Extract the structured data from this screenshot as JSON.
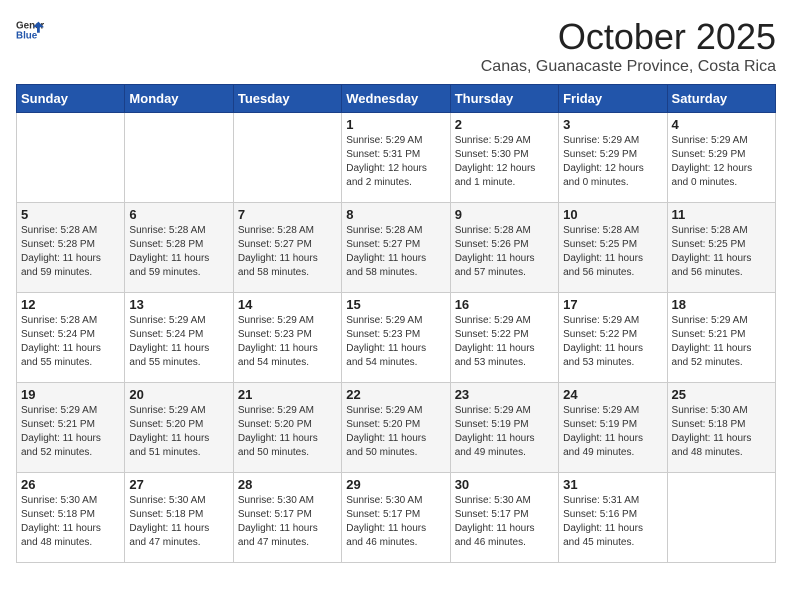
{
  "logo": {
    "general": "General",
    "blue": "Blue"
  },
  "title": "October 2025",
  "location": "Canas, Guanacaste Province, Costa Rica",
  "days_of_week": [
    "Sunday",
    "Monday",
    "Tuesday",
    "Wednesday",
    "Thursday",
    "Friday",
    "Saturday"
  ],
  "weeks": [
    [
      {
        "day": "",
        "info": ""
      },
      {
        "day": "",
        "info": ""
      },
      {
        "day": "",
        "info": ""
      },
      {
        "day": "1",
        "info": "Sunrise: 5:29 AM\nSunset: 5:31 PM\nDaylight: 12 hours\nand 2 minutes."
      },
      {
        "day": "2",
        "info": "Sunrise: 5:29 AM\nSunset: 5:30 PM\nDaylight: 12 hours\nand 1 minute."
      },
      {
        "day": "3",
        "info": "Sunrise: 5:29 AM\nSunset: 5:29 PM\nDaylight: 12 hours\nand 0 minutes."
      },
      {
        "day": "4",
        "info": "Sunrise: 5:29 AM\nSunset: 5:29 PM\nDaylight: 12 hours\nand 0 minutes."
      }
    ],
    [
      {
        "day": "5",
        "info": "Sunrise: 5:28 AM\nSunset: 5:28 PM\nDaylight: 11 hours\nand 59 minutes."
      },
      {
        "day": "6",
        "info": "Sunrise: 5:28 AM\nSunset: 5:28 PM\nDaylight: 11 hours\nand 59 minutes."
      },
      {
        "day": "7",
        "info": "Sunrise: 5:28 AM\nSunset: 5:27 PM\nDaylight: 11 hours\nand 58 minutes."
      },
      {
        "day": "8",
        "info": "Sunrise: 5:28 AM\nSunset: 5:27 PM\nDaylight: 11 hours\nand 58 minutes."
      },
      {
        "day": "9",
        "info": "Sunrise: 5:28 AM\nSunset: 5:26 PM\nDaylight: 11 hours\nand 57 minutes."
      },
      {
        "day": "10",
        "info": "Sunrise: 5:28 AM\nSunset: 5:25 PM\nDaylight: 11 hours\nand 56 minutes."
      },
      {
        "day": "11",
        "info": "Sunrise: 5:28 AM\nSunset: 5:25 PM\nDaylight: 11 hours\nand 56 minutes."
      }
    ],
    [
      {
        "day": "12",
        "info": "Sunrise: 5:28 AM\nSunset: 5:24 PM\nDaylight: 11 hours\nand 55 minutes."
      },
      {
        "day": "13",
        "info": "Sunrise: 5:29 AM\nSunset: 5:24 PM\nDaylight: 11 hours\nand 55 minutes."
      },
      {
        "day": "14",
        "info": "Sunrise: 5:29 AM\nSunset: 5:23 PM\nDaylight: 11 hours\nand 54 minutes."
      },
      {
        "day": "15",
        "info": "Sunrise: 5:29 AM\nSunset: 5:23 PM\nDaylight: 11 hours\nand 54 minutes."
      },
      {
        "day": "16",
        "info": "Sunrise: 5:29 AM\nSunset: 5:22 PM\nDaylight: 11 hours\nand 53 minutes."
      },
      {
        "day": "17",
        "info": "Sunrise: 5:29 AM\nSunset: 5:22 PM\nDaylight: 11 hours\nand 53 minutes."
      },
      {
        "day": "18",
        "info": "Sunrise: 5:29 AM\nSunset: 5:21 PM\nDaylight: 11 hours\nand 52 minutes."
      }
    ],
    [
      {
        "day": "19",
        "info": "Sunrise: 5:29 AM\nSunset: 5:21 PM\nDaylight: 11 hours\nand 52 minutes."
      },
      {
        "day": "20",
        "info": "Sunrise: 5:29 AM\nSunset: 5:20 PM\nDaylight: 11 hours\nand 51 minutes."
      },
      {
        "day": "21",
        "info": "Sunrise: 5:29 AM\nSunset: 5:20 PM\nDaylight: 11 hours\nand 50 minutes."
      },
      {
        "day": "22",
        "info": "Sunrise: 5:29 AM\nSunset: 5:20 PM\nDaylight: 11 hours\nand 50 minutes."
      },
      {
        "day": "23",
        "info": "Sunrise: 5:29 AM\nSunset: 5:19 PM\nDaylight: 11 hours\nand 49 minutes."
      },
      {
        "day": "24",
        "info": "Sunrise: 5:29 AM\nSunset: 5:19 PM\nDaylight: 11 hours\nand 49 minutes."
      },
      {
        "day": "25",
        "info": "Sunrise: 5:30 AM\nSunset: 5:18 PM\nDaylight: 11 hours\nand 48 minutes."
      }
    ],
    [
      {
        "day": "26",
        "info": "Sunrise: 5:30 AM\nSunset: 5:18 PM\nDaylight: 11 hours\nand 48 minutes."
      },
      {
        "day": "27",
        "info": "Sunrise: 5:30 AM\nSunset: 5:18 PM\nDaylight: 11 hours\nand 47 minutes."
      },
      {
        "day": "28",
        "info": "Sunrise: 5:30 AM\nSunset: 5:17 PM\nDaylight: 11 hours\nand 47 minutes."
      },
      {
        "day": "29",
        "info": "Sunrise: 5:30 AM\nSunset: 5:17 PM\nDaylight: 11 hours\nand 46 minutes."
      },
      {
        "day": "30",
        "info": "Sunrise: 5:30 AM\nSunset: 5:17 PM\nDaylight: 11 hours\nand 46 minutes."
      },
      {
        "day": "31",
        "info": "Sunrise: 5:31 AM\nSunset: 5:16 PM\nDaylight: 11 hours\nand 45 minutes."
      },
      {
        "day": "",
        "info": ""
      }
    ]
  ]
}
